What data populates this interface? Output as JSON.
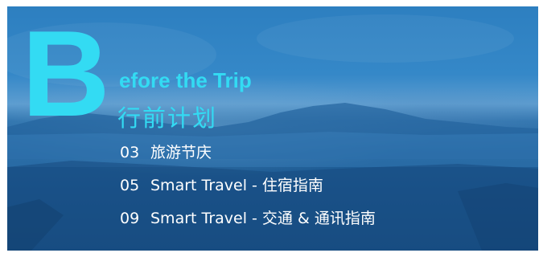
{
  "header": {
    "initial": "B",
    "title_rest": "efore the Trip",
    "title_cn": "行前计划"
  },
  "toc": [
    {
      "page": "03",
      "label": "旅游节庆"
    },
    {
      "page": "05",
      "label": "Smart Travel - 住宿指南"
    },
    {
      "page": "09",
      "label": "Smart Travel - 交通 & 通讯指南"
    }
  ],
  "colors": {
    "accent": "#33dbf3",
    "text": "#ffffff",
    "overlay": "#1b5e9a"
  }
}
